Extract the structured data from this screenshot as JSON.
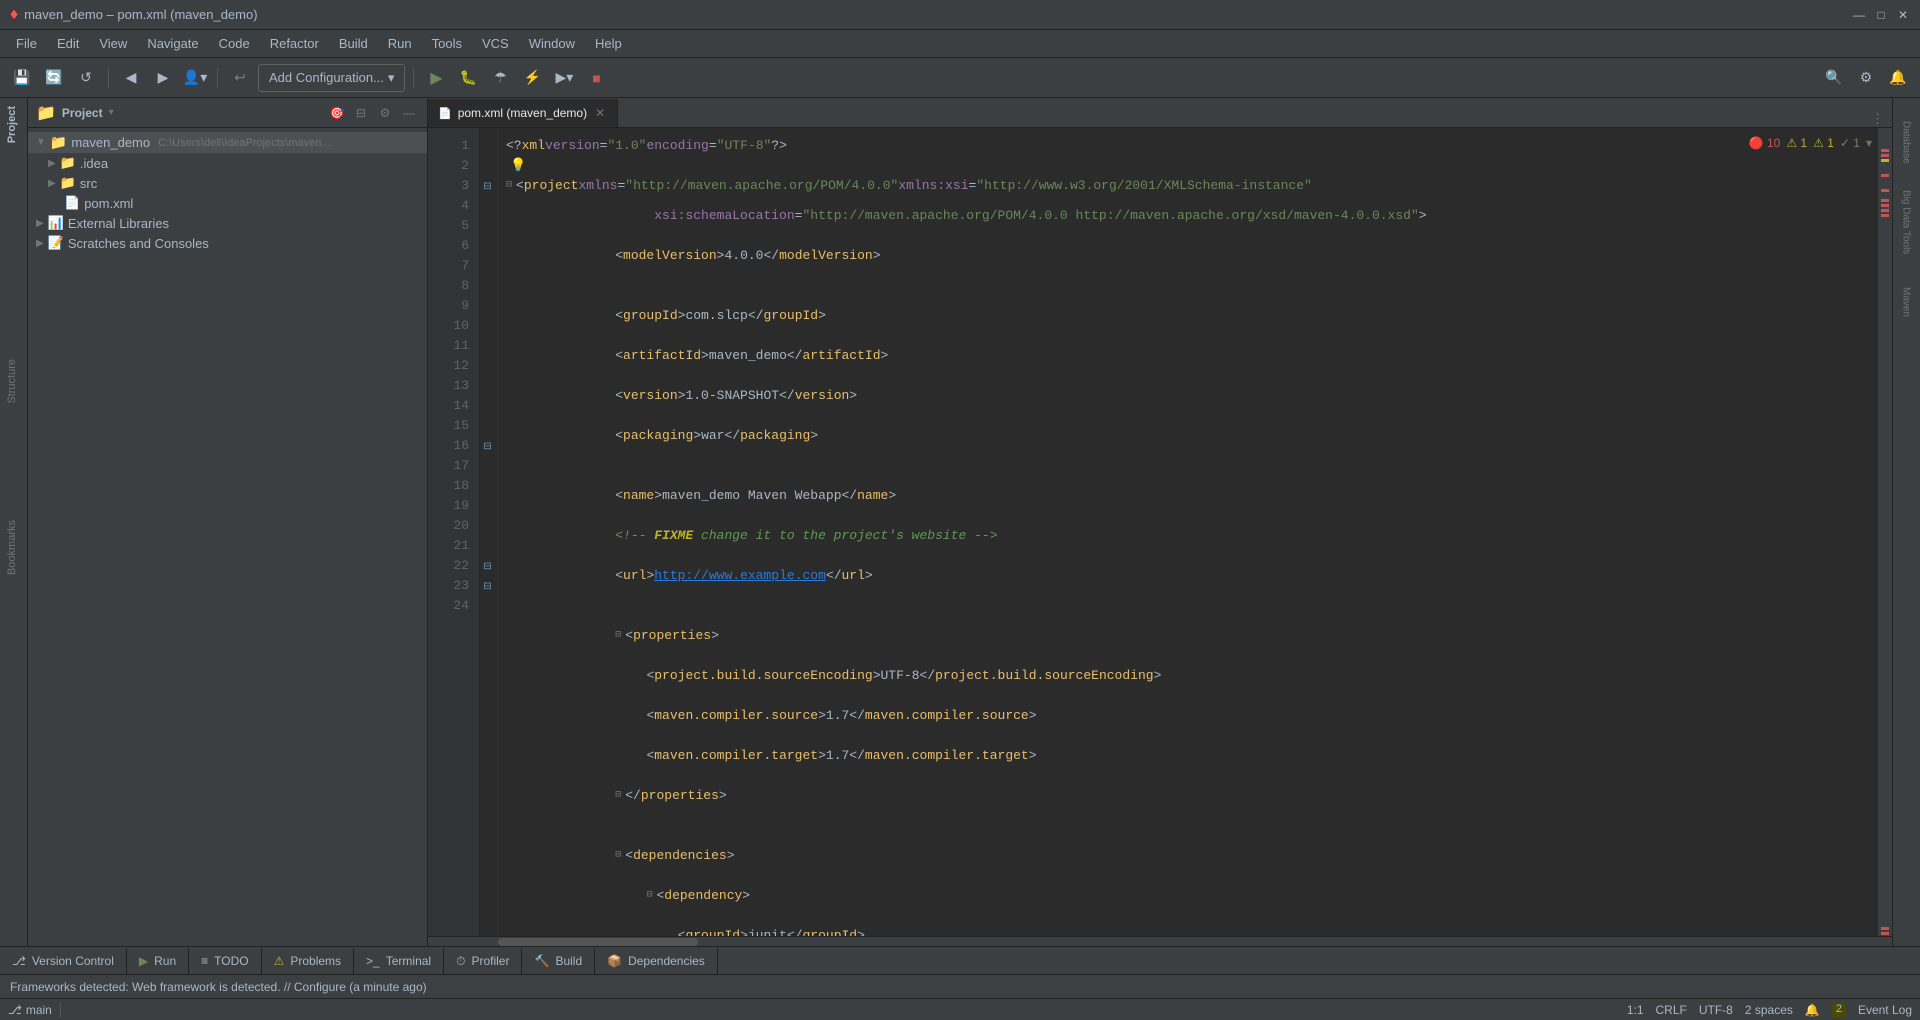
{
  "window": {
    "title": "maven_demo – pom.xml (maven_demo)",
    "app_icon": "♦"
  },
  "menu": {
    "items": [
      "File",
      "Edit",
      "View",
      "Navigate",
      "Code",
      "Refactor",
      "Build",
      "Run",
      "Tools",
      "VCS",
      "Window",
      "Help"
    ]
  },
  "toolbar": {
    "add_config_label": "Add Configuration...",
    "nav_back": "◀",
    "nav_forward": "▶",
    "save": "💾",
    "sync": "🔄",
    "run_icon": "▶",
    "debug_icon": "🐛",
    "minimize": "—",
    "maximize": "□",
    "close": "✕"
  },
  "project_panel": {
    "title": "Project",
    "root": {
      "name": "maven_demo",
      "path": "C:\\Users\\dell\\IdeaProjects\\maven...",
      "children": [
        {
          "name": ".idea",
          "type": "folder",
          "indent": 1
        },
        {
          "name": "src",
          "type": "folder",
          "indent": 1
        },
        {
          "name": "pom.xml",
          "type": "xml",
          "indent": 1
        }
      ]
    },
    "external_libraries": {
      "name": "External Libraries",
      "type": "folder",
      "indent": 0
    },
    "scratches": {
      "name": "Scratches and Consoles",
      "type": "folder",
      "indent": 0
    }
  },
  "editor": {
    "tab_label": "pom.xml (maven_demo)",
    "tab_icon": "📄",
    "errors": "10",
    "warnings": "1",
    "inspections": "1",
    "passed": "1",
    "lines": [
      {
        "num": 1,
        "content": "<?xml version=\"1.0\" encoding=\"UTF-8\"?>"
      },
      {
        "num": 2,
        "content": ""
      },
      {
        "num": 3,
        "content": "<project xmlns=\"http://maven.apache.org/POM/4.0.0\" xmlns:xsi=\"http://www.w3.org/2001/XMLSchema-instance\""
      },
      {
        "num": 4,
        "content": "         xsi:schemaLocation=\"http://maven.apache.org/POM/4.0.0 http://maven.apache.org/xsd/maven-4.0.0.xsd\">"
      },
      {
        "num": 5,
        "content": "    <modelVersion>4.0.0</modelVersion>"
      },
      {
        "num": 6,
        "content": ""
      },
      {
        "num": 7,
        "content": "    <groupId>com.slcp</groupId>"
      },
      {
        "num": 8,
        "content": "    <artifactId>maven_demo</artifactId>"
      },
      {
        "num": 9,
        "content": "    <version>1.0-SNAPSHOT</version>"
      },
      {
        "num": 10,
        "content": "    <packaging>war</packaging>"
      },
      {
        "num": 11,
        "content": ""
      },
      {
        "num": 12,
        "content": "    <name>maven_demo Maven Webapp</name>"
      },
      {
        "num": 13,
        "content": "    <!-- FIXME change it to the project's website -->"
      },
      {
        "num": 14,
        "content": "    <url>http://www.example.com</url>"
      },
      {
        "num": 15,
        "content": ""
      },
      {
        "num": 16,
        "content": "    <properties>"
      },
      {
        "num": 17,
        "content": "        <project.build.sourceEncoding>UTF-8</project.build.sourceEncoding>"
      },
      {
        "num": 18,
        "content": "        <maven.compiler.source>1.7</maven.compiler.source>"
      },
      {
        "num": 19,
        "content": "        <maven.compiler.target>1.7</maven.compiler.target>"
      },
      {
        "num": 20,
        "content": "    </properties>"
      },
      {
        "num": 21,
        "content": ""
      },
      {
        "num": 22,
        "content": "    <dependencies>"
      },
      {
        "num": 23,
        "content": "        <dependency>"
      },
      {
        "num": 24,
        "content": "            <groupId>junit</groupId>"
      }
    ]
  },
  "bottom_tabs": [
    {
      "label": "Version Control",
      "icon": "⎇",
      "active": false
    },
    {
      "label": "Run",
      "icon": "▶",
      "active": false
    },
    {
      "label": "TODO",
      "icon": "≡",
      "active": false
    },
    {
      "label": "Problems",
      "icon": "⚠",
      "active": false
    },
    {
      "label": "Terminal",
      "icon": ">_",
      "active": false
    },
    {
      "label": "Profiler",
      "icon": "⏱",
      "active": false
    },
    {
      "label": "Build",
      "icon": "🔨",
      "active": false
    },
    {
      "label": "Dependencies",
      "icon": "📦",
      "active": false
    }
  ],
  "status_bar": {
    "line_col": "1:1",
    "line_sep": "CRLF",
    "encoding": "UTF-8",
    "indent": "2 spaces",
    "event_log": "Event Log",
    "event_count": "2",
    "notification": "Frameworks detected: Web framework is detected. // Configure (a minute ago)"
  },
  "right_tabs": [
    "Database",
    "Big Data Tools",
    "Maven"
  ],
  "left_tabs": [
    "Structure",
    "Bookmarks"
  ]
}
